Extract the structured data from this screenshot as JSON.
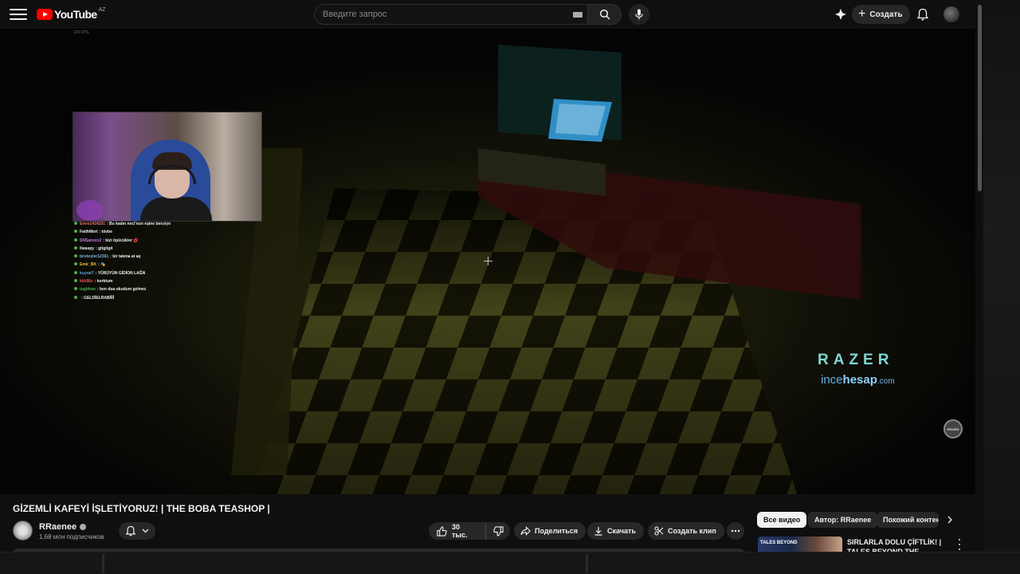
{
  "header": {
    "logo_text": "YouTube",
    "country_code": "AZ",
    "search_placeholder": "Введите запрос",
    "create_label": "Создать"
  },
  "player": {
    "overlay_fps": "120 FPS",
    "chat": [
      {
        "user": "Emre1424291",
        "text": ": Bu kadın neci'nun eşine benziyo",
        "color": "#e57373"
      },
      {
        "user": "FatihMert",
        "text": ": tövbe",
        "color": "#f0f0f0"
      },
      {
        "user": "SNSanxxx2",
        "text": ": bizi öpücükler 💋",
        "color": "#c97ae8"
      },
      {
        "user": "llwaspy",
        "text": ": gitgitgit",
        "color": "#f0f0f0"
      },
      {
        "user": "birzteyler12361",
        "text": ": bir takma at aq",
        "color": "#7fb3e6"
      },
      {
        "user": "Emir_BK",
        "text": ": 🎭",
        "color": "#f0c040"
      },
      {
        "user": "kuyrat7",
        "text": ": YÜRÜYÜN GİDİON LAĞN",
        "color": "#5fa0e0"
      },
      {
        "user": "kkk88s",
        "text": ": korktum",
        "color": "#e05050"
      },
      {
        "user": "tugbhoo",
        "text": ": ben dua okudum gelmez",
        "color": "#4caf50"
      },
      {
        "user": "",
        "text": ": GELDİELRABİİİİ",
        "color": "#f0f0f0"
      }
    ],
    "sponsor_brand": "RAZER",
    "sponsor_site_a": "ince",
    "sponsor_site_b": "hesap",
    "sponsor_site_c": ".com",
    "watermark_text": "REISEN"
  },
  "video": {
    "title": "GİZEMLİ KAFEYİ İŞLETİYORUZ! | THE BOBA TEASHOP |",
    "channel_name": "RRaenee",
    "subscribers": "1,68 млн подписчиков",
    "likes": "30 тыс.",
    "share_label": "Поделиться",
    "download_label": "Скачать",
    "clip_label": "Создать клип"
  },
  "sidebar": {
    "chips": [
      "Все видео",
      "Автор: RRaenee",
      "Похожий контент"
    ],
    "recommendation": {
      "thumb_text": "TALES BEYOND",
      "title": "SIRLARLA DOLU ÇİFTLİK! | TALES BEYOND THE BOMB -"
    }
  },
  "colors": {
    "brand_red": "#ff0000",
    "background": "#0f0f0f",
    "pill_bg": "#272727"
  }
}
